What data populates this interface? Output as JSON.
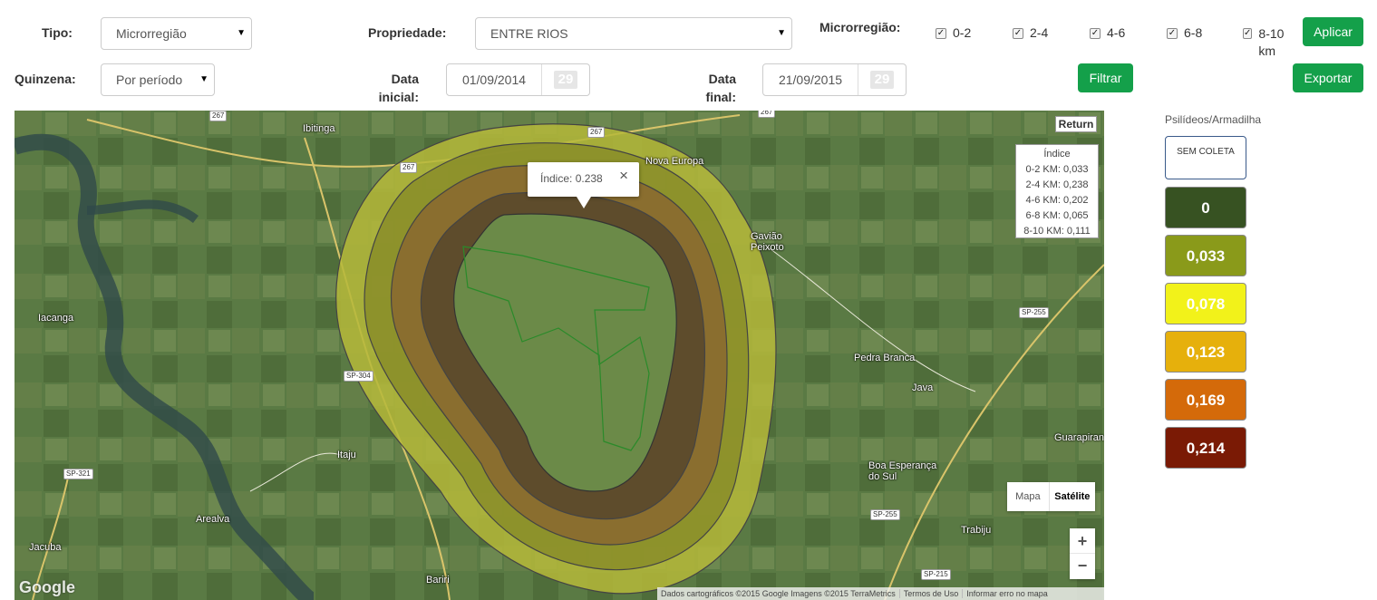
{
  "filters": {
    "tipo_label": "Tipo:",
    "tipo_value": "Microrregião",
    "propriedade_label": "Propriedade:",
    "propriedade_value": "ENTRE RIOS",
    "microrregiao_label": "Microrregião:",
    "ranges": [
      "0-2",
      "2-4",
      "4-6",
      "6-8",
      "8-10 km"
    ],
    "quinzena_label": "Quinzena:",
    "quinzena_value": "Por período",
    "data_inicial_label": "Data inicial:",
    "data_inicial_value": "01/09/2014",
    "data_final_label": "Data final:",
    "data_final_value": "21/09/2015",
    "calendar_day": "29"
  },
  "buttons": {
    "aplicar": "Aplicar",
    "filtrar": "Filtrar",
    "exportar": "Exportar"
  },
  "map": {
    "return_label": "Return",
    "popup_text": "Índice: 0.238",
    "popup_close": "×",
    "indice_title": "Índice",
    "indice_lines": [
      "0-2 KM: 0,033",
      "2-4 KM: 0,238",
      "4-6 KM: 0,202",
      "6-8 KM: 0,065",
      "8-10 KM: 0,111"
    ],
    "map_type": {
      "mapa": "Mapa",
      "satelite": "Satélite"
    },
    "zoom_in": "+",
    "zoom_out": "−",
    "google": "Google",
    "attribution": "Dados cartográficos ©2015 Google Imagens ©2015 TerraMetrics",
    "terms": "Termos de Uso",
    "report": "Informar erro no mapa",
    "places": {
      "ibitinga": "Ibitinga",
      "nova_europa": "Nova Europa",
      "gaviao": "Gavião Peixoto",
      "iacanga": "Iacanga",
      "pedra_branca": "Pedra Branca",
      "java": "Java",
      "itaju": "Itaju",
      "boa_esperanca": "Boa Esperança do Sul",
      "guarapiranga": "Guarapiran",
      "trabiju": "Trabiju",
      "arealva": "Arealva",
      "jacuba": "Jacuba",
      "bariri": "Bariri"
    },
    "roads": {
      "r267a": "267",
      "r267b": "267",
      "r267c": "267",
      "r267d": "267",
      "sp255a": "SP-255",
      "sp255b": "SP-255",
      "sp304": "SP-304",
      "sp321": "SP-321",
      "sp215": "SP-215"
    }
  },
  "legend": {
    "title": "Psilídeos/Armadilha",
    "sem_coleta": "SEM COLETA",
    "items": [
      {
        "label": "0",
        "color": "#375222"
      },
      {
        "label": "0,033",
        "color": "#8a9a1a"
      },
      {
        "label": "0,078",
        "color": "#f2f21a"
      },
      {
        "label": "0,123",
        "color": "#e6b00c"
      },
      {
        "label": "0,169",
        "color": "#d46a0a"
      },
      {
        "label": "0,214",
        "color": "#7a1a05"
      }
    ]
  },
  "colors": {
    "accent_green": "#14a04a"
  }
}
